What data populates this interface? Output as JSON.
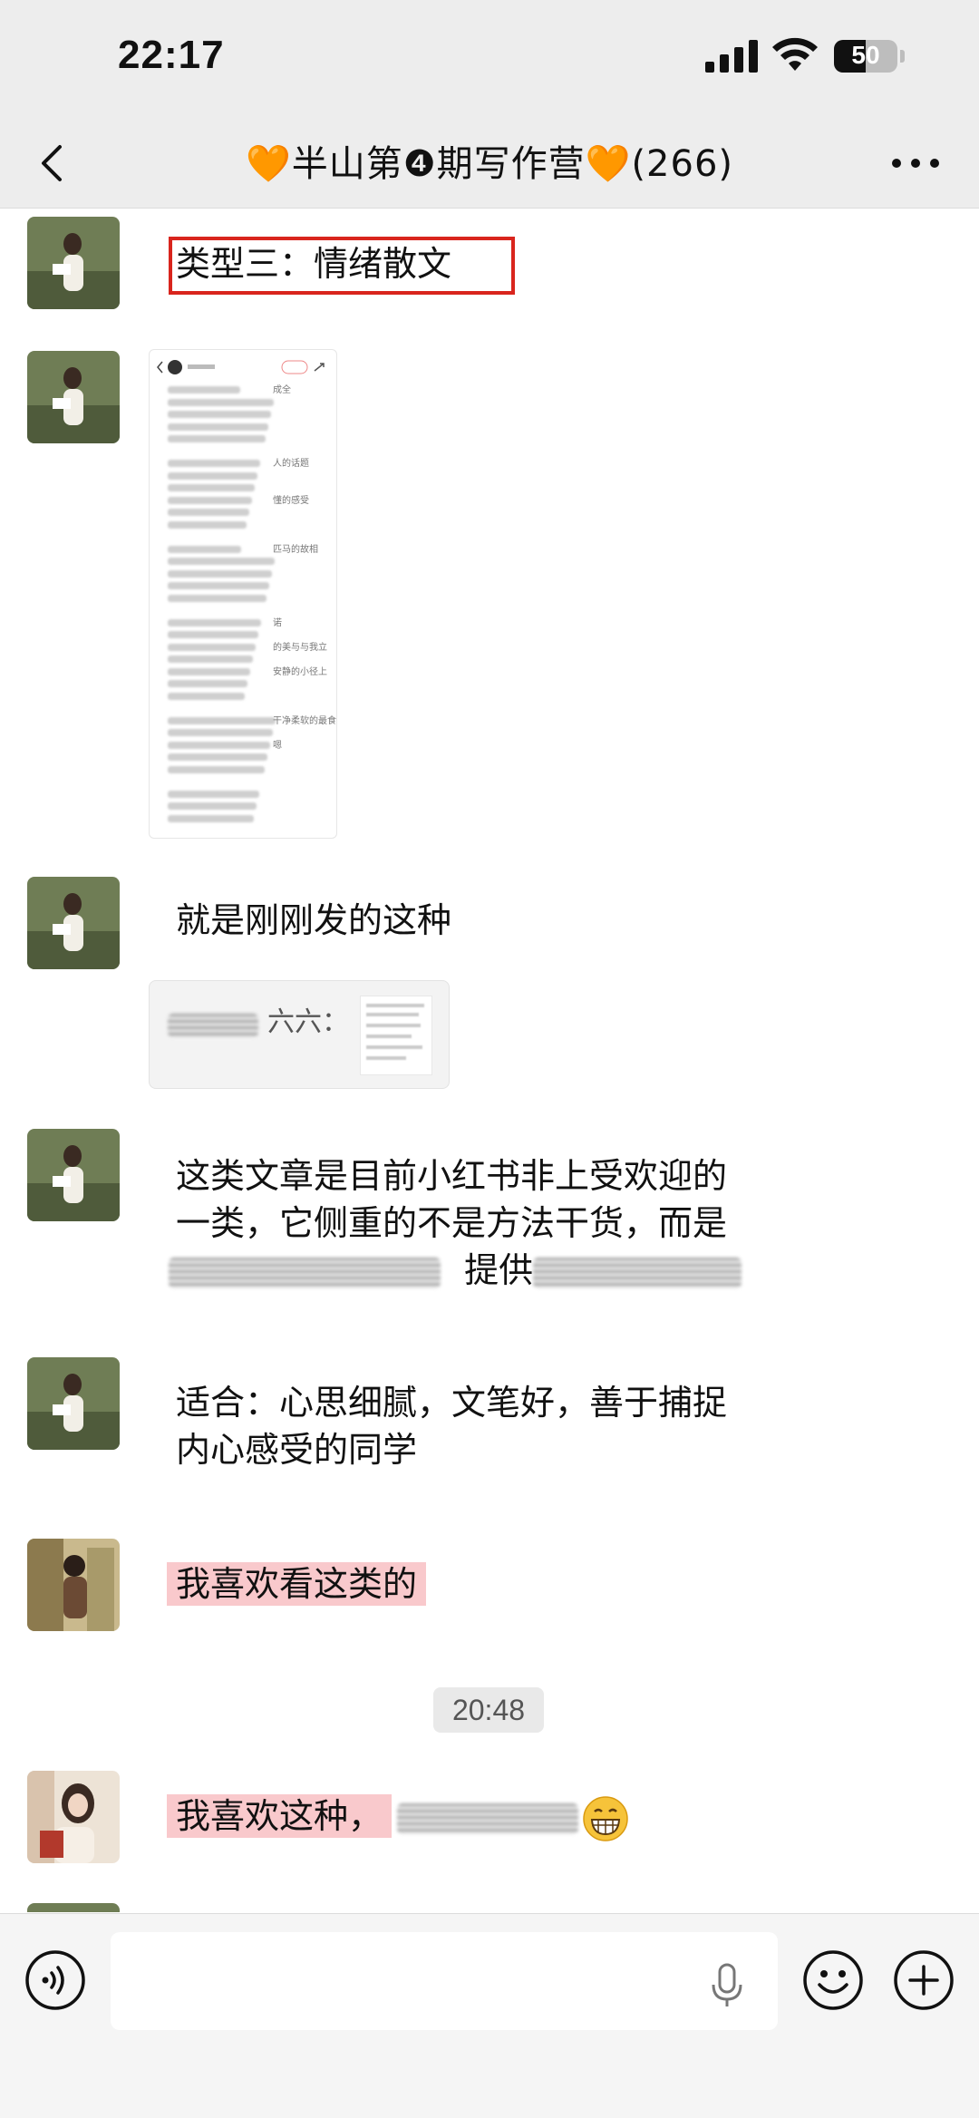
{
  "status_bar": {
    "time": "22:17",
    "battery": "50",
    "battery_level": 0.5
  },
  "nav": {
    "title": "🧡半山第❹期写作营🧡(266)"
  },
  "messages": {
    "m1": {
      "text": "类型三：情绪散文"
    },
    "m2": {
      "card_tags": [
        "成全",
        "人的话题",
        "懂的感受",
        "匹马的故相",
        "诺",
        "的美与与我立",
        "安静的小径上",
        "干净柔软的最食",
        "嗯"
      ]
    },
    "m3": {
      "text": "就是刚刚发的这种",
      "quote_name": "六六："
    },
    "m4": {
      "line1": "这类文章是目前小红书非上受欢迎的",
      "line2": "一类，它侧重的不是方法干货，而是",
      "line3_mid": "提供"
    },
    "m5": {
      "line1": "适合：心思细腻，文笔好，善于捕捉",
      "line2": "内心感受的同学"
    },
    "m6": {
      "text": "我喜欢看这类的"
    },
    "timestamp": "20:48",
    "m7": {
      "text": "我喜欢这种，"
    }
  },
  "input": {
    "placeholder": ""
  },
  "icons": {
    "back": "chevron-left-icon",
    "more": "more-dots-icon",
    "voice": "voice-icon",
    "mic": "microphone-icon",
    "emoji": "emoji-icon",
    "plus": "plus-circle-icon"
  },
  "colors": {
    "highlight": "#f9c9cc",
    "box_border": "#d9251d",
    "bar_bg": "#ededed"
  }
}
